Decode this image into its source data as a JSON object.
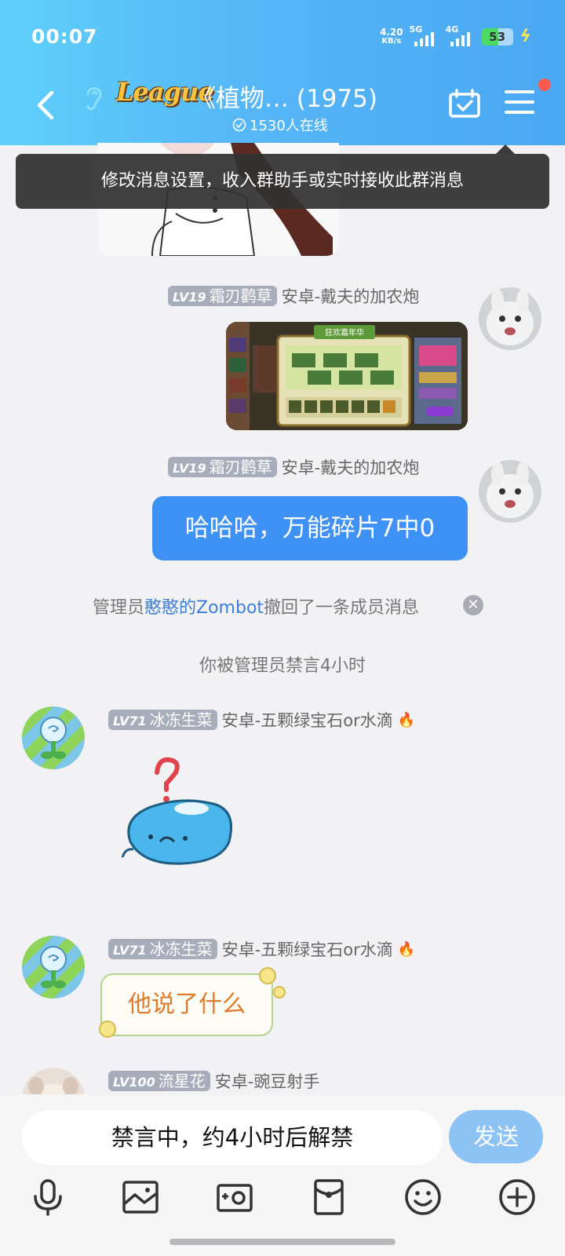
{
  "status_bar": {
    "time": "00:07",
    "net_speed_value": "4.20",
    "net_speed_unit": "KB/s",
    "sim1_tag": "5G",
    "sim2_tag": "4G",
    "battery": "53"
  },
  "header": {
    "logo_text": "League",
    "title": "《植物…  (1975)",
    "online": "1530人在线"
  },
  "tooltip": "修改消息设置，收入群助手或实时接收此群消息",
  "messages": [
    {
      "level": "LV19",
      "name": "霜刃鹳草",
      "title": "安卓-戴夫的加农炮"
    },
    {
      "level": "LV19",
      "name": "霜刃鹳草",
      "title": "安卓-戴夫的加农炮",
      "text": "哈哈哈，万能碎片7中0"
    },
    {
      "level": "LV71",
      "name": "冰冻生菜",
      "title": "安卓-五颗绿宝石or水滴"
    },
    {
      "level": "LV71",
      "name": "冰冻生菜",
      "title": "安卓-五颗绿宝石or水滴",
      "text": "他说了什么"
    },
    {
      "level": "LV100",
      "name": "流星花",
      "title": "安卓-豌豆射手"
    }
  ],
  "system": {
    "recall_prefix": "管理员",
    "recall_admin": "憨憨的Zombot",
    "recall_suffix": "撤回了一条成员消息",
    "muted_notice": "你被管理员禁言4小时"
  },
  "game_screenshot": {
    "banner": "狂欢嘉年华",
    "side_banner": "狂欢嘉年华",
    "personal_label": "个人累计奖励"
  },
  "input": {
    "muted_text": "禁言中，约4小时后解禁",
    "send_label": "发送"
  },
  "colors": {
    "header_gradient_start": "#5fd0fb",
    "header_gradient_end": "#4aa7f2",
    "bubble_blue": "#3f92f5",
    "admin_link": "#3d7fd8",
    "send_button": "#8cc2f4"
  }
}
